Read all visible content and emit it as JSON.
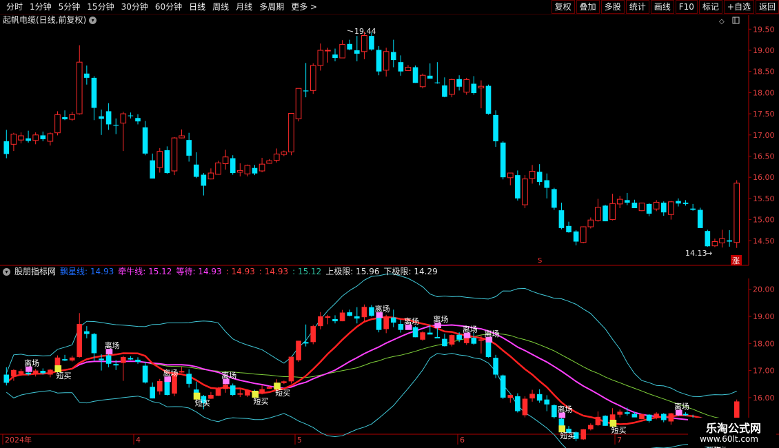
{
  "toolbar": {
    "periods": [
      "分时",
      "1分钟",
      "5分钟",
      "15分钟",
      "30分钟",
      "60分钟",
      "日线",
      "周线",
      "月线",
      "多周期",
      "更多 >"
    ],
    "active_period": "日线",
    "right_buttons": [
      "复权",
      "叠加",
      "多股",
      "统计",
      "画线",
      "F10",
      "标记",
      "+自选",
      "返回"
    ]
  },
  "main_chart": {
    "title": "起帆电缆(日线,前复权)",
    "y_ticks": [
      "19.50",
      "19.00",
      "18.50",
      "18.00",
      "17.50",
      "17.00",
      "16.50",
      "16.00",
      "15.50",
      "15.00",
      "14.50"
    ],
    "y_min": 14.0,
    "y_max": 19.7,
    "high_label": "19.44",
    "low_label": "14.13",
    "zhang_badge": "涨",
    "s_marker": "S"
  },
  "indicator": {
    "name": "股朋指标网",
    "values": [
      {
        "label": "飘星线: 14.93",
        "color": "#1e6dff"
      },
      {
        "label": "牵牛线: 15.12",
        "color": "#ff40ff"
      },
      {
        "label": "等待: 14.93",
        "color": "#ff40ff"
      },
      {
        "label": ": 14.93",
        "color": "#ff4040"
      },
      {
        "label": ": 14.93",
        "color": "#ff4040"
      },
      {
        "label": ": 15.12",
        "color": "#30c0a0"
      },
      {
        "label": "上极限: 15.96",
        "color": "#e6e6e6"
      },
      {
        "label": "下极限: 14.29",
        "color": "#e6e6e6"
      }
    ],
    "y_ticks": [
      "20.00",
      "19.00",
      "18.00",
      "17.00",
      "16.00",
      "15.00"
    ],
    "y_min": 14.7,
    "y_max": 20.4,
    "signal_leave": "离场",
    "signal_buy": "短买"
  },
  "x_axis": {
    "labels": [
      "2024年",
      "4",
      "5",
      "6",
      "7"
    ]
  },
  "watermark": {
    "line1": "乐淘公式网",
    "line2": "www.60lt.com"
  },
  "colors": {
    "up": "#ff2a2a",
    "down": "#00e5ff",
    "axis": "#b00000",
    "mid_line": "#ff2020",
    "ma_pink": "#ff40ff",
    "ma_green": "#7fd03a",
    "band": "#40c8d8",
    "signal_yellow": "#e8f040",
    "signal_pink": "#ff80ff"
  },
  "chart_data": {
    "type": "candlestick",
    "x_labels": [
      "2024年",
      "4",
      "5",
      "6",
      "7"
    ],
    "candles": [
      {
        "o": 16.85,
        "h": 17.12,
        "l": 16.45,
        "c": 16.55
      },
      {
        "o": 16.78,
        "h": 17.05,
        "l": 16.62,
        "c": 17.02
      },
      {
        "o": 16.88,
        "h": 17.06,
        "l": 16.8,
        "c": 16.98
      },
      {
        "o": 16.92,
        "h": 17.1,
        "l": 16.82,
        "c": 16.86
      },
      {
        "o": 16.87,
        "h": 17.06,
        "l": 16.78,
        "c": 17.0
      },
      {
        "o": 16.99,
        "h": 17.08,
        "l": 16.85,
        "c": 16.9
      },
      {
        "o": 16.85,
        "h": 17.06,
        "l": 16.75,
        "c": 17.03
      },
      {
        "o": 17.05,
        "h": 17.56,
        "l": 16.99,
        "c": 17.48
      },
      {
        "o": 17.42,
        "h": 17.58,
        "l": 17.35,
        "c": 17.37
      },
      {
        "o": 17.37,
        "h": 17.55,
        "l": 17.33,
        "c": 17.48
      },
      {
        "o": 17.5,
        "h": 19.12,
        "l": 17.48,
        "c": 18.72
      },
      {
        "o": 18.45,
        "h": 18.64,
        "l": 18.19,
        "c": 18.35
      },
      {
        "o": 18.35,
        "h": 18.39,
        "l": 17.35,
        "c": 17.64
      },
      {
        "o": 17.44,
        "h": 17.6,
        "l": 17.0,
        "c": 17.38
      },
      {
        "o": 17.56,
        "h": 17.75,
        "l": 17.12,
        "c": 17.25
      },
      {
        "o": 17.24,
        "h": 17.39,
        "l": 17.02,
        "c": 17.22
      },
      {
        "o": 17.28,
        "h": 17.55,
        "l": 16.62,
        "c": 17.5
      },
      {
        "o": 17.46,
        "h": 17.53,
        "l": 17.39,
        "c": 17.45
      },
      {
        "o": 17.4,
        "h": 17.49,
        "l": 17.25,
        "c": 17.32
      },
      {
        "o": 17.18,
        "h": 17.33,
        "l": 16.52,
        "c": 16.56
      },
      {
        "o": 16.4,
        "h": 16.56,
        "l": 15.97,
        "c": 15.97
      },
      {
        "o": 16.23,
        "h": 16.69,
        "l": 16.11,
        "c": 16.61
      },
      {
        "o": 16.64,
        "h": 16.73,
        "l": 16.08,
        "c": 16.1
      },
      {
        "o": 16.15,
        "h": 16.95,
        "l": 16.05,
        "c": 16.93
      },
      {
        "o": 16.93,
        "h": 17.13,
        "l": 16.92,
        "c": 16.98
      },
      {
        "o": 16.88,
        "h": 17.05,
        "l": 16.37,
        "c": 16.51
      },
      {
        "o": 16.3,
        "h": 16.59,
        "l": 15.98,
        "c": 16.01
      },
      {
        "o": 16.06,
        "h": 16.1,
        "l": 15.57,
        "c": 15.8
      },
      {
        "o": 15.96,
        "h": 16.21,
        "l": 15.95,
        "c": 16.1
      },
      {
        "o": 16.07,
        "h": 16.39,
        "l": 16.06,
        "c": 16.34
      },
      {
        "o": 16.32,
        "h": 16.65,
        "l": 16.18,
        "c": 16.48
      },
      {
        "o": 16.45,
        "h": 16.52,
        "l": 16.06,
        "c": 16.1
      },
      {
        "o": 16.12,
        "h": 16.33,
        "l": 16.02,
        "c": 16.16
      },
      {
        "o": 16.08,
        "h": 16.3,
        "l": 16.02,
        "c": 16.28
      },
      {
        "o": 16.22,
        "h": 16.29,
        "l": 16.05,
        "c": 16.09
      },
      {
        "o": 16.15,
        "h": 16.46,
        "l": 16.12,
        "c": 16.31
      },
      {
        "o": 16.33,
        "h": 16.43,
        "l": 16.32,
        "c": 16.39
      },
      {
        "o": 16.4,
        "h": 16.68,
        "l": 16.35,
        "c": 16.55
      },
      {
        "o": 16.54,
        "h": 16.63,
        "l": 16.5,
        "c": 16.6
      },
      {
        "o": 16.6,
        "h": 17.51,
        "l": 16.52,
        "c": 17.51
      },
      {
        "o": 17.38,
        "h": 18.1,
        "l": 17.32,
        "c": 18.1
      },
      {
        "o": 18.05,
        "h": 18.7,
        "l": 17.89,
        "c": 18.03
      },
      {
        "o": 18.05,
        "h": 18.69,
        "l": 17.97,
        "c": 18.64
      },
      {
        "o": 18.64,
        "h": 19.16,
        "l": 18.52,
        "c": 19.0
      },
      {
        "o": 19.0,
        "h": 19.06,
        "l": 18.71,
        "c": 19.0
      },
      {
        "o": 18.9,
        "h": 19.04,
        "l": 18.74,
        "c": 18.82
      },
      {
        "o": 18.82,
        "h": 19.24,
        "l": 18.82,
        "c": 19.14
      },
      {
        "o": 19.15,
        "h": 19.25,
        "l": 19.0,
        "c": 19.02
      },
      {
        "o": 19.0,
        "h": 19.34,
        "l": 18.74,
        "c": 18.92
      },
      {
        "o": 18.97,
        "h": 19.44,
        "l": 18.79,
        "c": 19.35
      },
      {
        "o": 19.34,
        "h": 19.42,
        "l": 18.99,
        "c": 19.02
      },
      {
        "o": 19.01,
        "h": 19.1,
        "l": 18.41,
        "c": 18.5
      },
      {
        "o": 18.53,
        "h": 19.06,
        "l": 18.38,
        "c": 18.97
      },
      {
        "o": 18.96,
        "h": 19.25,
        "l": 18.6,
        "c": 18.77
      },
      {
        "o": 18.72,
        "h": 18.88,
        "l": 18.4,
        "c": 18.5
      },
      {
        "o": 18.52,
        "h": 18.65,
        "l": 18.51,
        "c": 18.6
      },
      {
        "o": 18.6,
        "h": 18.64,
        "l": 18.23,
        "c": 18.23
      },
      {
        "o": 18.14,
        "h": 18.45,
        "l": 18.1,
        "c": 18.41
      },
      {
        "o": 18.4,
        "h": 18.69,
        "l": 18.35,
        "c": 18.33
      },
      {
        "o": 18.24,
        "h": 18.72,
        "l": 18.21,
        "c": 18.23
      },
      {
        "o": 18.17,
        "h": 18.36,
        "l": 17.89,
        "c": 17.9
      },
      {
        "o": 17.96,
        "h": 18.33,
        "l": 17.89,
        "c": 18.31
      },
      {
        "o": 18.32,
        "h": 18.41,
        "l": 18.05,
        "c": 18.14
      },
      {
        "o": 18.01,
        "h": 18.35,
        "l": 17.95,
        "c": 18.31
      },
      {
        "o": 18.21,
        "h": 18.39,
        "l": 17.95,
        "c": 17.99
      },
      {
        "o": 18.11,
        "h": 18.29,
        "l": 17.63,
        "c": 18.15
      },
      {
        "o": 18.16,
        "h": 18.19,
        "l": 17.48,
        "c": 17.5
      },
      {
        "o": 17.47,
        "h": 17.58,
        "l": 16.72,
        "c": 16.85
      },
      {
        "o": 16.82,
        "h": 16.85,
        "l": 15.95,
        "c": 16.0
      },
      {
        "o": 15.99,
        "h": 16.06,
        "l": 15.81,
        "c": 16.1
      },
      {
        "o": 16.05,
        "h": 16.16,
        "l": 15.45,
        "c": 15.5
      },
      {
        "o": 15.35,
        "h": 16.05,
        "l": 15.27,
        "c": 15.96
      },
      {
        "o": 15.97,
        "h": 16.29,
        "l": 15.85,
        "c": 16.14
      },
      {
        "o": 16.13,
        "h": 16.31,
        "l": 15.81,
        "c": 15.89
      },
      {
        "o": 15.93,
        "h": 16.09,
        "l": 15.5,
        "c": 15.75
      },
      {
        "o": 15.72,
        "h": 15.75,
        "l": 15.23,
        "c": 15.28
      },
      {
        "o": 15.22,
        "h": 15.4,
        "l": 14.77,
        "c": 14.8
      },
      {
        "o": 14.85,
        "h": 14.95,
        "l": 14.69,
        "c": 14.7
      },
      {
        "o": 14.72,
        "h": 14.75,
        "l": 14.39,
        "c": 14.48
      },
      {
        "o": 14.46,
        "h": 14.84,
        "l": 14.44,
        "c": 14.83
      },
      {
        "o": 14.83,
        "h": 15.05,
        "l": 14.79,
        "c": 14.99
      },
      {
        "o": 14.98,
        "h": 15.49,
        "l": 14.95,
        "c": 15.29
      },
      {
        "o": 15.33,
        "h": 15.35,
        "l": 14.96,
        "c": 14.96
      },
      {
        "o": 15.0,
        "h": 15.61,
        "l": 14.98,
        "c": 15.38
      },
      {
        "o": 15.37,
        "h": 15.56,
        "l": 15.27,
        "c": 15.48
      },
      {
        "o": 15.46,
        "h": 15.63,
        "l": 15.34,
        "c": 15.4
      },
      {
        "o": 15.4,
        "h": 15.47,
        "l": 15.33,
        "c": 15.27
      },
      {
        "o": 15.21,
        "h": 15.4,
        "l": 15.2,
        "c": 15.39
      },
      {
        "o": 15.37,
        "h": 15.39,
        "l": 15.08,
        "c": 15.14
      },
      {
        "o": 15.25,
        "h": 15.46,
        "l": 15.2,
        "c": 15.41
      },
      {
        "o": 15.4,
        "h": 15.43,
        "l": 15.09,
        "c": 15.17
      },
      {
        "o": 15.12,
        "h": 15.44,
        "l": 15.0,
        "c": 15.42
      },
      {
        "o": 15.44,
        "h": 15.5,
        "l": 15.31,
        "c": 15.38
      },
      {
        "o": 15.4,
        "h": 15.46,
        "l": 15.33,
        "c": 15.37
      },
      {
        "o": 15.26,
        "h": 15.37,
        "l": 15.21,
        "c": 15.23
      },
      {
        "o": 15.23,
        "h": 15.28,
        "l": 14.94,
        "c": 14.8
      },
      {
        "o": 14.73,
        "h": 14.76,
        "l": 14.36,
        "c": 14.37
      },
      {
        "o": 14.38,
        "h": 14.55,
        "l": 14.35,
        "c": 14.48
      },
      {
        "o": 14.45,
        "h": 14.76,
        "l": 14.34,
        "c": 14.55
      },
      {
        "o": 14.51,
        "h": 14.75,
        "l": 14.36,
        "c": 14.48
      },
      {
        "o": 14.46,
        "h": 15.93,
        "l": 14.33,
        "c": 15.86
      }
    ],
    "indicator_lines": {
      "upper_band": "upper_band",
      "lower_band": "lower_band",
      "mid_line": "mid_line",
      "pink_line": "pink_line",
      "green_line": "green_line"
    }
  }
}
